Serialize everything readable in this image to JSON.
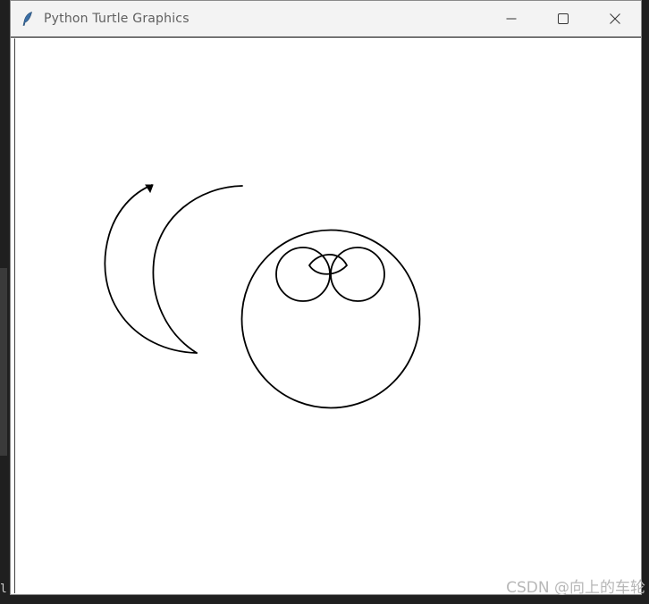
{
  "window": {
    "title": "Python Turtle Graphics",
    "controls": {
      "minimize_icon": "minimize-icon",
      "maximize_icon": "maximize-icon",
      "close_icon": "close-icon"
    }
  },
  "canvas": {
    "drawing": {
      "stroke_color": "#000000",
      "background": "#ffffff"
    }
  },
  "overlay": {
    "watermark": "CSDN @向上的车轮",
    "left_edge_text": "l"
  }
}
